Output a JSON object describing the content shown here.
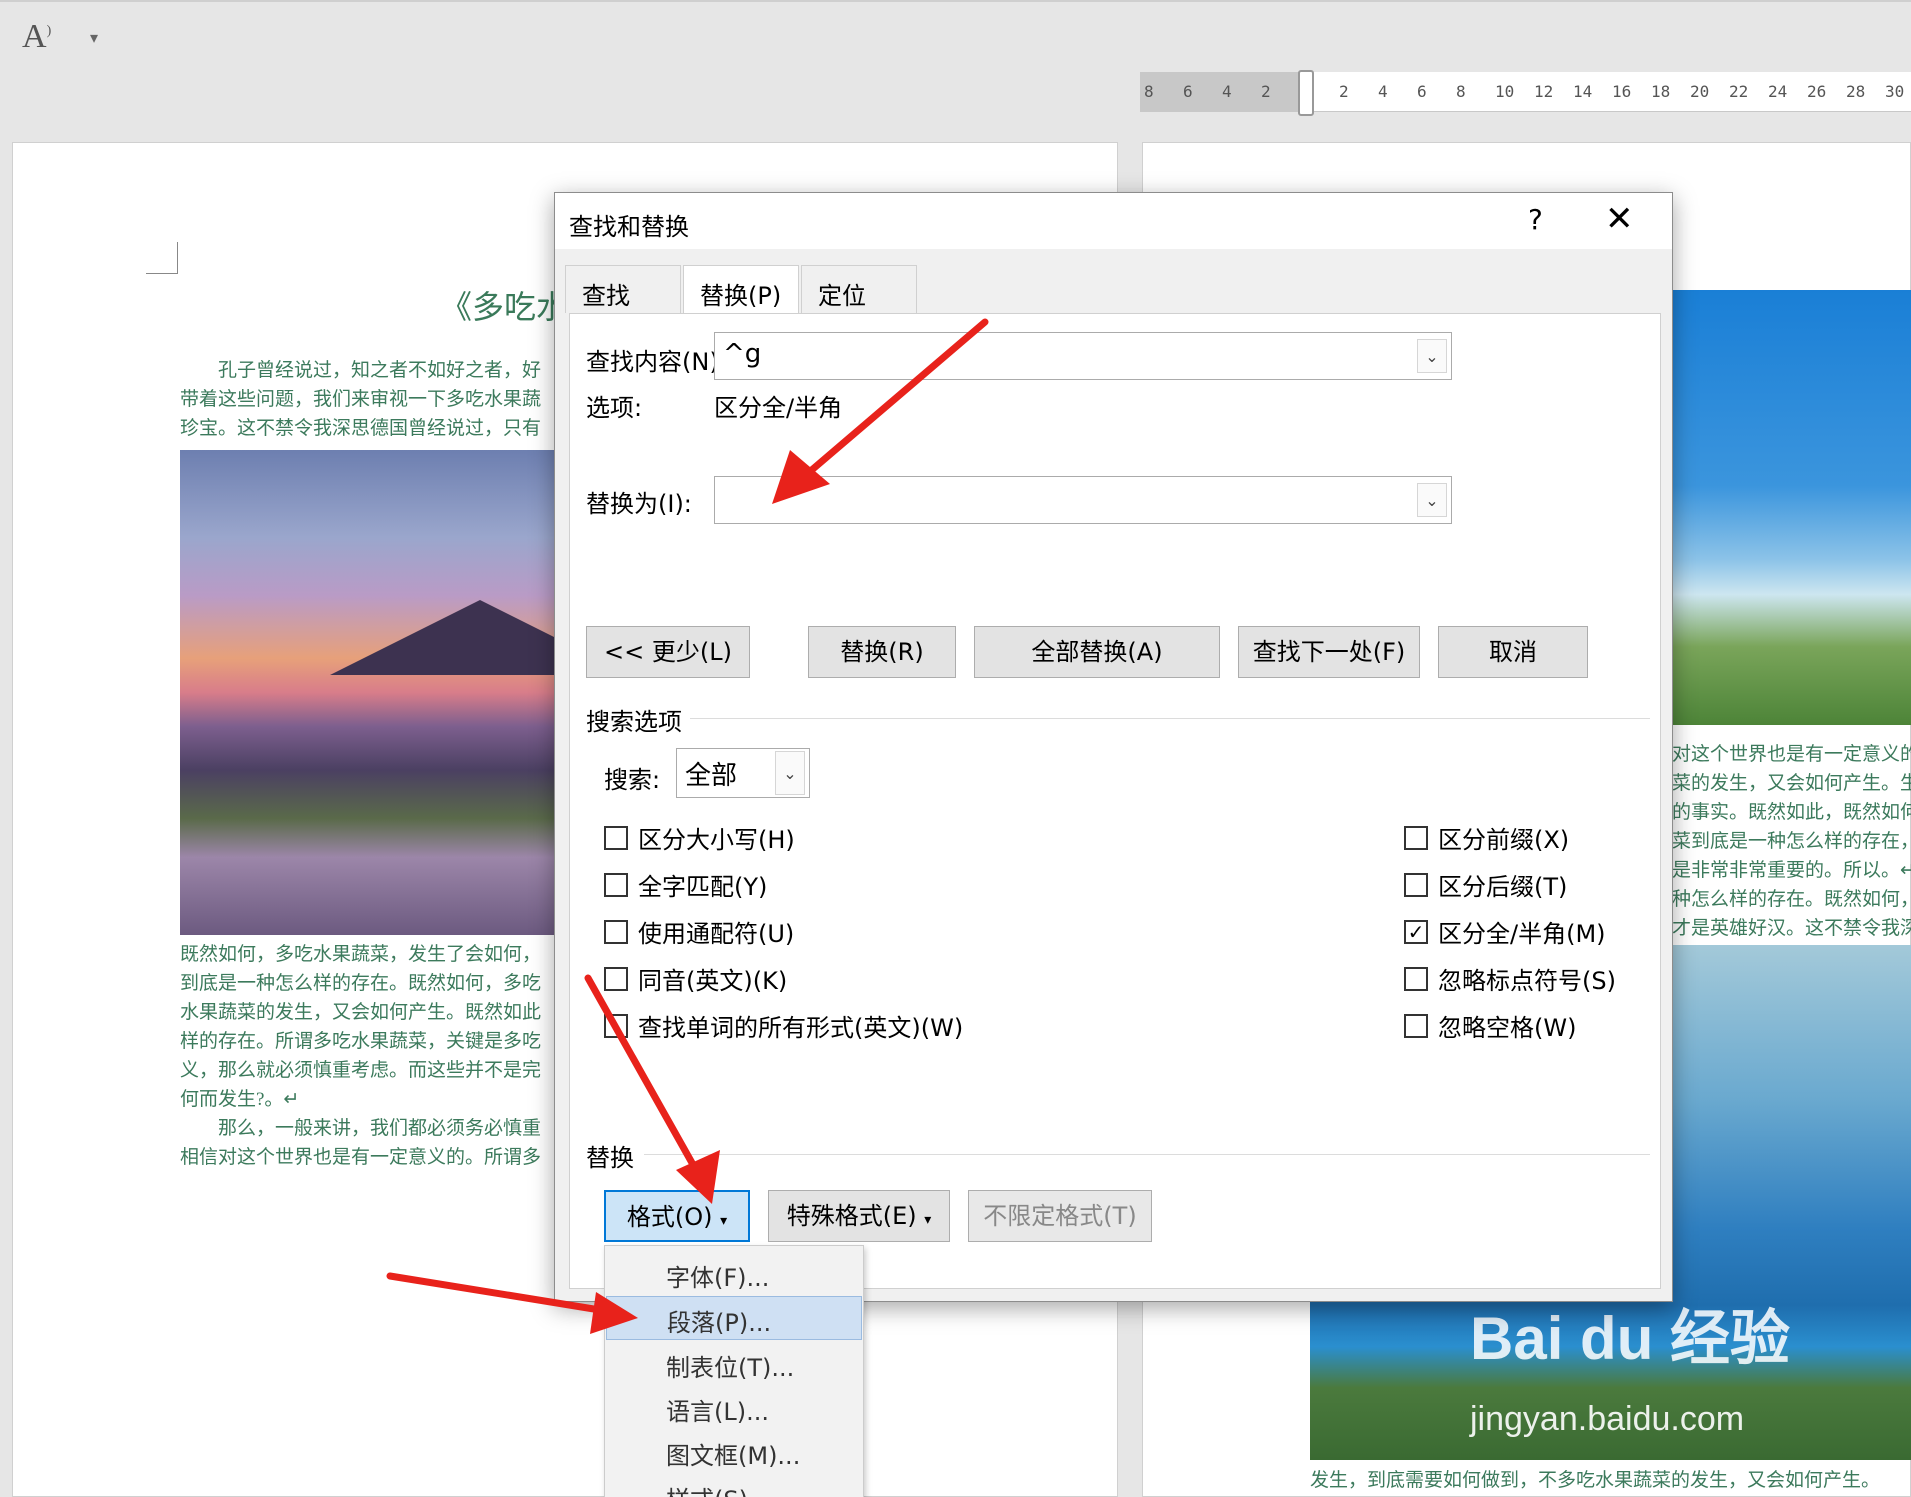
{
  "toolbar": {
    "read_aloud_glyph": "A",
    "qa_caret": "▾"
  },
  "ruler": {
    "marks": [
      "8",
      "6",
      "4",
      "2",
      "",
      "2",
      "4",
      "6",
      "8",
      "10",
      "12",
      "14",
      "16",
      "18",
      "20",
      "22",
      "24",
      "26",
      "28",
      "30"
    ]
  },
  "document": {
    "title": "《多吃水",
    "left_lines": [
      "孔子曾经说过，知之者不如好之者，好",
      "带着这些问题，我们来审视一下多吃水果蔬",
      "珍宝。这不禁令我深思德国曾经说过，只有"
    ],
    "left_lines_below": [
      "既然如何，多吃水果蔬菜，发生了会如何，",
      "到底是一种怎么样的存在。既然如何，多吃",
      "水果蔬菜的发生，又会如何产生。既然如此",
      "样的存在。所谓多吃水果蔬菜，关键是多吃",
      "义，那么就必须慎重考虑。而这些并不是完",
      "何而发生?。↵",
      "　　那么，一般来讲，我们都必须务必慎重",
      "相信对这个世界也是有一定意义的。所谓多"
    ],
    "right_lines": [
      "对这个世界也是有一定意义的",
      "菜的发生，又会如何产生。生",
      "的事实。既然如此，既然如何",
      "菜到底是一种怎么样的存在，",
      "是非常非常重要的。所以。↵",
      "种怎么样的存在。既然如何，",
      "才是英雄好汉。这不禁令我深"
    ],
    "right_bottom_line": "发生，到底需要如何做到，不多吃水果蔬菜的发生，又会如何产生。",
    "watermark": "Bai du 经验",
    "watermark_url": "jingyan.baidu.com"
  },
  "dialog": {
    "title": "查找和替换",
    "help": "?",
    "close": "✕",
    "tabs": [
      {
        "label": "查找(D)",
        "active": false
      },
      {
        "label": "替换(P)",
        "active": true
      },
      {
        "label": "定位(G)",
        "active": false
      }
    ],
    "find_label": "查找内容(N):",
    "find_value": "^g",
    "options_label": "选项:",
    "options_value": "区分全/半角",
    "replace_label": "替换为(I):",
    "replace_value": "",
    "buttons": {
      "less": "<< 更少(L)",
      "replace": "替换(R)",
      "replace_all": "全部替换(A)",
      "find_next": "查找下一处(F)",
      "cancel": "取消"
    },
    "search_options_header": "搜索选项",
    "search_label": "搜索:",
    "search_value": "全部",
    "left_checks": [
      {
        "label": "区分大小写(H)",
        "checked": false
      },
      {
        "label": "全字匹配(Y)",
        "checked": false
      },
      {
        "label": "使用通配符(U)",
        "checked": false
      },
      {
        "label": "同音(英文)(K)",
        "checked": false
      },
      {
        "label": "查找单词的所有形式(英文)(W)",
        "checked": false
      }
    ],
    "right_checks": [
      {
        "label": "区分前缀(X)",
        "checked": false
      },
      {
        "label": "区分后缀(T)",
        "checked": false
      },
      {
        "label": "区分全/半角(M)",
        "checked": true
      },
      {
        "label": "忽略标点符号(S)",
        "checked": false
      },
      {
        "label": "忽略空格(W)",
        "checked": false
      }
    ],
    "replace_header": "替换",
    "format_button": "格式(O)",
    "special_button": "特殊格式(E)",
    "no_format_button": "不限定格式(T)",
    "check_mark": "✓",
    "dropdown_arrow": "⌄"
  },
  "format_menu": {
    "items": [
      {
        "label": "字体(F)...",
        "highlighted": false
      },
      {
        "label": "段落(P)...",
        "highlighted": true
      },
      {
        "label": "制表位(T)...",
        "highlighted": false
      },
      {
        "label": "语言(L)...",
        "highlighted": false
      },
      {
        "label": "图文框(M)...",
        "highlighted": false
      },
      {
        "label": "样式(S)...",
        "highlighted": false
      }
    ]
  },
  "colors": {
    "accent": "#0078d7",
    "arrow": "#e8221b",
    "doc_text": "#3c7a5c"
  }
}
